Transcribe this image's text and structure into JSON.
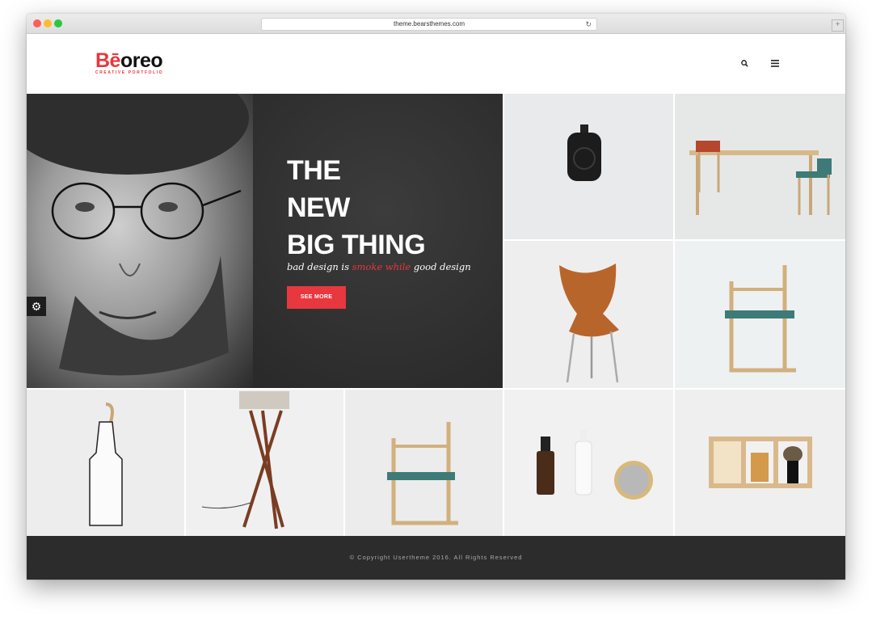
{
  "browser": {
    "url": "theme.bearsthemes.com",
    "reload_icon": "↻",
    "new_tab_icon": "+"
  },
  "header": {
    "logo_first": "Bē",
    "logo_rest": "oreo",
    "logo_sub": "CREATIVE PORTFOLIO",
    "search_icon": "search-icon",
    "menu_icon": "menu-icon"
  },
  "hero": {
    "title_line1": "THE",
    "title_line2": "NEW",
    "title_line3": "BIG THING",
    "tagline_start": "bad design is ",
    "tagline_highlight": "smoke while",
    "tagline_end": " good design",
    "button_label": "SEE MORE"
  },
  "settings_icon": "gear-icon",
  "footer": {
    "copyright": "© Copyright Usertheme 2016. All Rights Reserved"
  },
  "colors": {
    "accent": "#e8373e",
    "hero_bg": "#2a2a2a",
    "footer_bg": "#2c2c2c"
  }
}
